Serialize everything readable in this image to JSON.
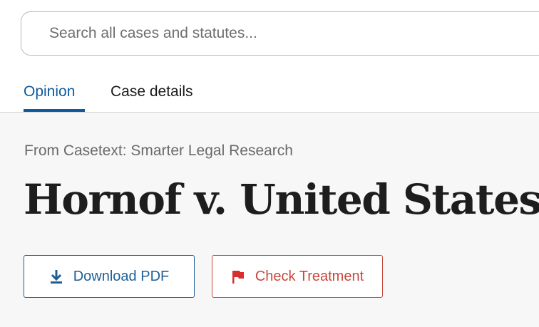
{
  "search": {
    "placeholder": "Search all cases and statutes..."
  },
  "tabs": [
    {
      "label": "Opinion",
      "active": true
    },
    {
      "label": "Case details",
      "active": false
    }
  ],
  "header": {
    "source": "From Casetext: Smarter Legal Research",
    "title": "Hornof v. United States"
  },
  "actions": {
    "download_label": "Download PDF",
    "download_icon": "download-icon",
    "check_label": "Check Treatment",
    "check_icon": "flag-icon"
  },
  "colors": {
    "accent": "#0e5a9c",
    "danger": "#c9473c",
    "flag": "#d92e2e",
    "background": "#f7f7f7"
  }
}
